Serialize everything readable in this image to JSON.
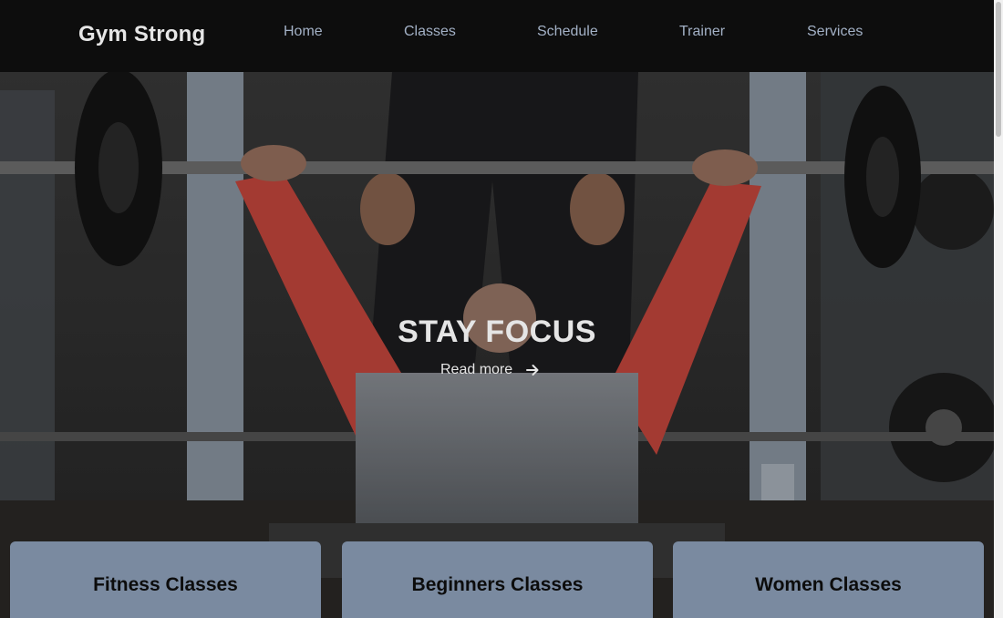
{
  "brand": {
    "name": "Gym Strong"
  },
  "nav": {
    "items": [
      {
        "label": "Home"
      },
      {
        "label": "Classes"
      },
      {
        "label": "Schedule"
      },
      {
        "label": "Trainer"
      },
      {
        "label": "Services"
      }
    ]
  },
  "hero": {
    "title": "STAY FOCUS",
    "cta_label": "Read more",
    "cta_icon": "arrow-right-icon",
    "image_subject": "man bench pressing barbell with spotter in gym"
  },
  "cards": [
    {
      "title": "Fitness Classes"
    },
    {
      "title": "Beginners Classes"
    },
    {
      "title": "Women Classes"
    }
  ],
  "colors": {
    "navbar_bg": "#0d0d0d",
    "nav_link": "#a3b1c6",
    "card_bg": "#7a8aa0",
    "shirt_red": "#c7473d"
  }
}
